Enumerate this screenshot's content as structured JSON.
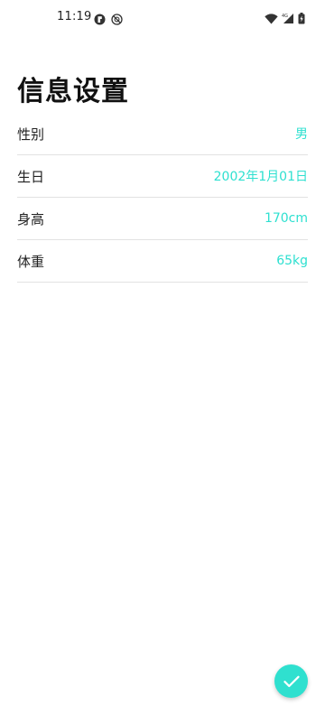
{
  "status_bar": {
    "time": "11:19",
    "left_icons": [
      "badge-icon",
      "no-tracking-icon"
    ],
    "right_icons": [
      "wifi-icon",
      "signal-4g-icon",
      "battery-charging-icon"
    ]
  },
  "page": {
    "title": "信息设置"
  },
  "settings": {
    "items": [
      {
        "label": "性别",
        "value": "男"
      },
      {
        "label": "生日",
        "value": "2002年1月01日"
      },
      {
        "label": "身高",
        "value": "170cm"
      },
      {
        "label": "体重",
        "value": "65kg"
      }
    ]
  },
  "fab": {
    "icon": "check-icon"
  },
  "colors": {
    "accent": "#2fe0cf",
    "divider": "#e2e2e2",
    "text": "#222222"
  }
}
